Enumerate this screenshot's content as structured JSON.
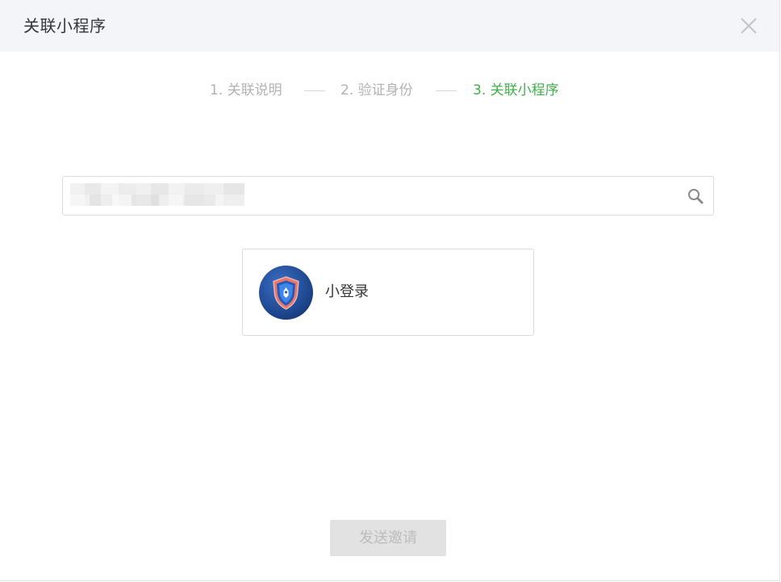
{
  "dialog": {
    "title": "关联小程序",
    "close_icon": "close-icon"
  },
  "steps": [
    {
      "label": "1. 关联说明",
      "state": "done"
    },
    {
      "label": "2. 验证身份",
      "state": "done"
    },
    {
      "label": "3. 关联小程序",
      "state": "active"
    }
  ],
  "colors": {
    "active_step": "#3fb14a",
    "inactive_step": "#b2b2b2",
    "header_bg": "#f4f5f9",
    "button_disabled_bg": "#e2e2e2",
    "button_disabled_text": "#bcbcbc"
  },
  "search": {
    "value": "",
    "value_obscured": true,
    "icon": "search-icon"
  },
  "result": {
    "name": "小登录",
    "avatar_icon": "shield-logo-icon"
  },
  "footer": {
    "send_label": "发送邀请",
    "send_disabled": true
  }
}
